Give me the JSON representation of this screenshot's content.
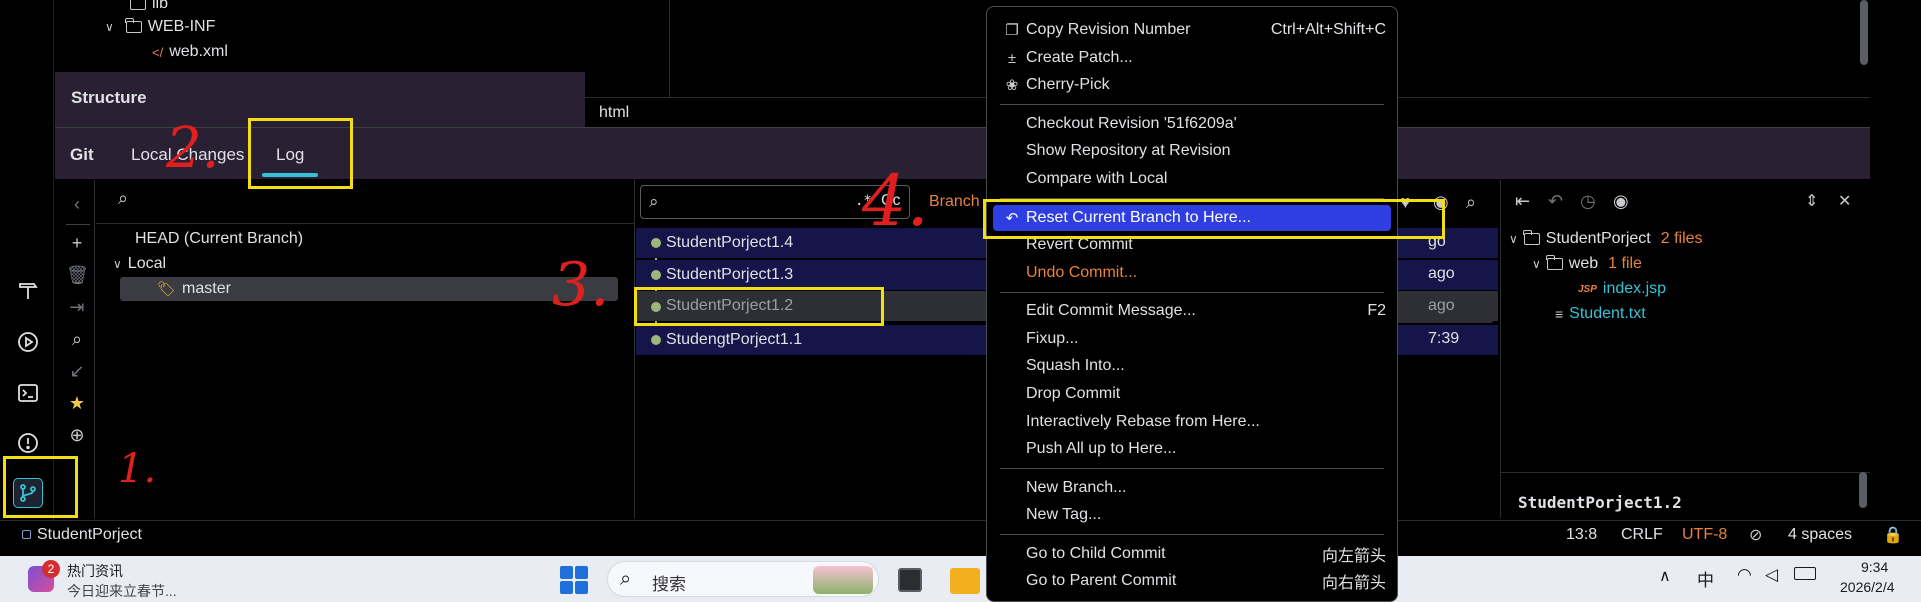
{
  "project_tree": {
    "items": [
      {
        "label": "lib"
      },
      {
        "label": "WEB-INF"
      },
      {
        "label": "web.xml"
      }
    ]
  },
  "editor": {
    "breadcrumb": "html"
  },
  "structure": {
    "title": "Structure"
  },
  "git": {
    "title": "Git",
    "tabs": [
      {
        "label": "Local Changes"
      },
      {
        "label": "Log",
        "active": true
      }
    ]
  },
  "branches": {
    "head": "HEAD (Current Branch)",
    "local": "Local",
    "master": "master"
  },
  "log": {
    "search_regex": ".*",
    "search_case": "Cc",
    "branch_filter": "Branch",
    "commits": [
      {
        "message": "StudentPorject1.4",
        "time": "go"
      },
      {
        "message": "StudentPorject1.3",
        "time": "ago"
      },
      {
        "message": "StudentPorject1.2",
        "time": "ago"
      },
      {
        "message": "StudengtPorject1.1",
        "time": "7:39"
      }
    ]
  },
  "details": {
    "root": "StudentPorject",
    "root_count": "2 files",
    "folder": "web",
    "folder_count": "1 file",
    "file1_icon": "JSP",
    "file1": "index.jsp",
    "file2": "Student.txt",
    "commit_title": "StudentPorject1.2"
  },
  "context_menu": {
    "items": [
      {
        "label": "Copy Revision Number",
        "shortcut": "Ctrl+Alt+Shift+C",
        "icon": "copy-icon"
      },
      {
        "label": "Create Patch...",
        "icon": "patch-icon"
      },
      {
        "label": "Cherry-Pick",
        "icon": "cherry-icon"
      },
      {
        "label": "Checkout Revision '51f6209a'"
      },
      {
        "label": "Show Repository at Revision"
      },
      {
        "label": "Compare with Local"
      },
      {
        "label": "Reset Current Branch to Here...",
        "icon": "undo-icon",
        "active": true
      },
      {
        "label": "Revert Commit"
      },
      {
        "label": "Undo Commit...",
        "color": "#e8813b"
      },
      {
        "label": "Edit Commit Message...",
        "shortcut": "F2"
      },
      {
        "label": "Fixup..."
      },
      {
        "label": "Squash Into..."
      },
      {
        "label": "Drop Commit"
      },
      {
        "label": "Interactively Rebase from Here..."
      },
      {
        "label": "Push All up to Here..."
      },
      {
        "label": "New Branch..."
      },
      {
        "label": "New Tag..."
      },
      {
        "label": "Go to Child Commit",
        "shortcut": "向左箭头"
      },
      {
        "label": "Go to Parent Commit",
        "shortcut": "向右箭头"
      }
    ]
  },
  "status_bar": {
    "project": "StudentPorject",
    "position": "13:8",
    "line_ending": "CRLF",
    "encoding": "UTF-8",
    "indent": "4 spaces"
  },
  "taskbar": {
    "news_badge": "2",
    "news_title": "热门资讯",
    "news_sub": "今日迎来立春节...",
    "search_placeholder": "搜索",
    "ime": "中",
    "time": "9:34",
    "date": "2026/2/4"
  },
  "annotations": {
    "step1": "1.",
    "step2": "2.",
    "step3": "3.",
    "step4": "4."
  },
  "colors": {
    "accent": "#35c2d6",
    "menu_highlight": "#2f3ee0",
    "annotation_box": "#f3de14",
    "annotation_ink": "#e0201f",
    "orange": "#e8813b",
    "cyan_file": "#35c2d6"
  }
}
